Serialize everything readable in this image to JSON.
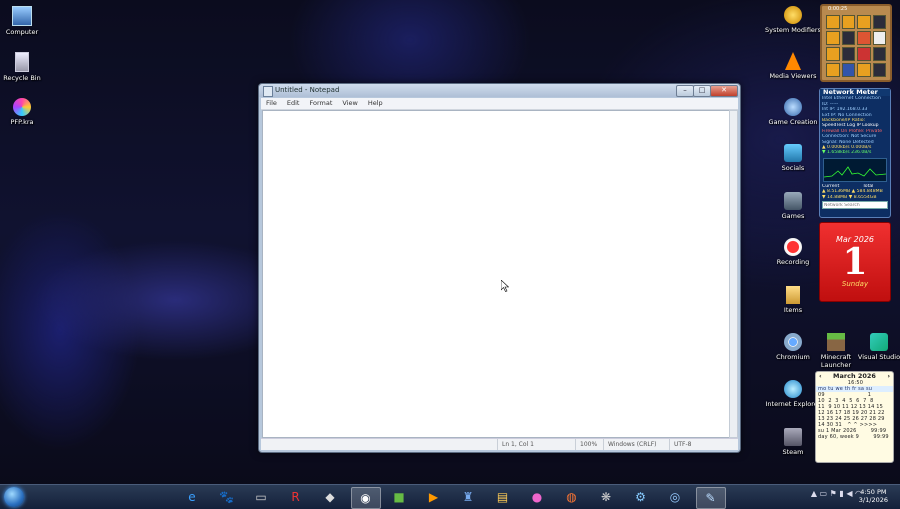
{
  "desktop_left": [
    {
      "label": "Computer",
      "icon": "computer-icon"
    },
    {
      "label": "Recycle Bin",
      "icon": "recycle-bin-icon"
    },
    {
      "label": "PFP.kra",
      "icon": "krita-file-icon"
    }
  ],
  "desktop_right": [
    {
      "label": "System Modifiers",
      "icon": "system-modifiers-icon"
    },
    {
      "label": "Media Viewers",
      "icon": "vlc-cone-icon"
    },
    {
      "label": "Game Creation",
      "icon": "game-creation-icon"
    },
    {
      "label": "Socials",
      "icon": "socials-icon"
    },
    {
      "label": "Games",
      "icon": "games-icon"
    },
    {
      "label": "Recording",
      "icon": "recording-icon"
    },
    {
      "label": "Items",
      "icon": "folder-icon"
    },
    {
      "label": "Chromium",
      "icon": "chromium-icon"
    },
    {
      "label": "Minecraft Launcher",
      "icon": "minecraft-icon"
    },
    {
      "label": "Visual Studio",
      "icon": "visual-studio-icon"
    },
    {
      "label": "Internet Explorer",
      "icon": "internet-explorer-icon"
    },
    {
      "label": "Steam",
      "icon": "steam-icon"
    }
  ],
  "notepad": {
    "title": "Untitled - Notepad",
    "menu": [
      "File",
      "Edit",
      "Format",
      "View",
      "Help"
    ],
    "status": {
      "position": "Ln 1, Col 1",
      "zoom": "100%",
      "line_ending": "Windows (CRLF)",
      "encoding": "UTF-8"
    }
  },
  "gadgets": {
    "tiles_header": "0:00:25",
    "network_meter": {
      "title": "Network Meter",
      "lines": [
        "Intel Ethernet Connection",
        "ID: -----",
        "Int IP: 192.168.0.33",
        "Ext IP: No Connection",
        "Backbone/IP Ratio:",
        "SpeedTest  Log  IP Lookup",
        "Firewall On   Profile: Private",
        "Connection: Not Secure",
        "Signal: None Detected",
        "▲ 0.000kb/s   0.000B/s",
        "▼ 1.658kb/s   236.0B/s"
      ],
      "totals_label_current": "Current",
      "totals_label_total": "Total",
      "totals": [
        "▲ 8.5136MB   ▲ 584.848MB",
        "▼ 14.88MB   ▼ 8.6554GB"
      ],
      "search_placeholder": "Network Search"
    },
    "calendar": {
      "month": "Mar 2026",
      "day": "1",
      "weekday": "Sunday"
    },
    "mini_calendar": {
      "header": "March 2026",
      "time": "16:50",
      "weekdays": "mo tu we th fr sa su",
      "rows": [
        "09                        1",
        "10  2  3  4  5  6  7  8",
        "11  9 10 11 12 13 14 15",
        "12 16 17 18 19 20 21 22",
        "13 23 24 25 26 27 28 29",
        "14 30 31   ^ ^ >>>>"
      ],
      "footer1": "su 1 Mar 2026        99:99",
      "footer2": "day 60, week 9        99:99"
    }
  },
  "taskbar": {
    "apps": [
      {
        "name": "internet-explorer",
        "glyph": "e",
        "color": "#3aa0ff"
      },
      {
        "name": "gimp",
        "glyph": "🐾",
        "color": "#c9a76a"
      },
      {
        "name": "terminal",
        "glyph": "▭",
        "color": "#ccc"
      },
      {
        "name": "roblox",
        "glyph": "R",
        "color": "#e33"
      },
      {
        "name": "unity",
        "glyph": "◆",
        "color": "#ddd"
      },
      {
        "name": "obs",
        "glyph": "◉",
        "color": "#fff"
      },
      {
        "name": "minecraft",
        "glyph": "■",
        "color": "#6b4"
      },
      {
        "name": "media-player",
        "glyph": "▶",
        "color": "#f90"
      },
      {
        "name": "game-tools",
        "glyph": "♜",
        "color": "#7ae"
      },
      {
        "name": "file-explorer",
        "glyph": "▤",
        "color": "#fc5"
      },
      {
        "name": "krita",
        "glyph": "●",
        "color": "#e6c"
      },
      {
        "name": "firefox",
        "glyph": "◍",
        "color": "#f73"
      },
      {
        "name": "davinci-resolve",
        "glyph": "❋",
        "color": "#ccc"
      },
      {
        "name": "settings",
        "glyph": "⚙",
        "color": "#8cf"
      },
      {
        "name": "browser",
        "glyph": "◎",
        "color": "#9cf"
      },
      {
        "name": "notepad",
        "glyph": "✎",
        "color": "#bdf"
      }
    ],
    "time": "4:50 PM",
    "date": "3/1/2026"
  }
}
